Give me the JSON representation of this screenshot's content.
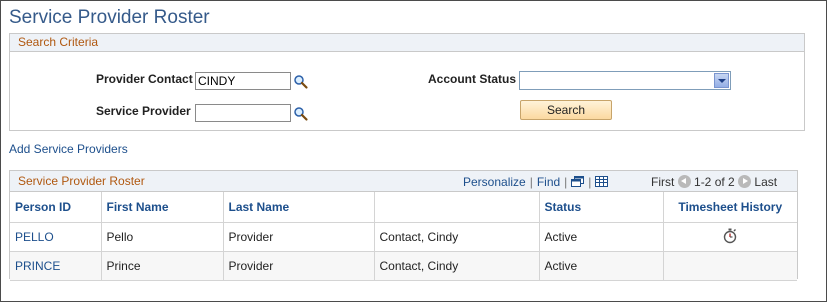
{
  "page": {
    "title": "Service Provider Roster"
  },
  "search": {
    "header": "Search Criteria",
    "provider_contact_label": "Provider Contact",
    "provider_contact_value": "CINDY",
    "service_provider_label": "Service Provider",
    "service_provider_value": "",
    "account_status_label": "Account Status",
    "account_status_value": "",
    "search_button": "Search"
  },
  "links": {
    "add_service_providers": "Add Service Providers"
  },
  "grid": {
    "title": "Service Provider Roster",
    "personalize": "Personalize",
    "find": "Find",
    "first": "First",
    "range": "1-2 of 2",
    "last": "Last",
    "columns": [
      "Person ID",
      "First Name",
      "Last Name",
      "",
      "Status",
      "Timesheet History"
    ],
    "rows": [
      {
        "person_id": "PELLO",
        "first_name": "Pello",
        "last_name": "Provider",
        "contact": "Contact, Cindy",
        "status": "Active",
        "timesheet_icon": "stopwatch-icon"
      },
      {
        "person_id": "PRINCE",
        "first_name": "Prince",
        "last_name": "Provider",
        "contact": "Contact, Cindy",
        "status": "Active",
        "timesheet_icon": ""
      }
    ]
  },
  "colors": {
    "title": "#355a8a",
    "section_header_text": "#b05810",
    "link": "#1d4f8c",
    "button_bg": "#fbd9a0"
  }
}
